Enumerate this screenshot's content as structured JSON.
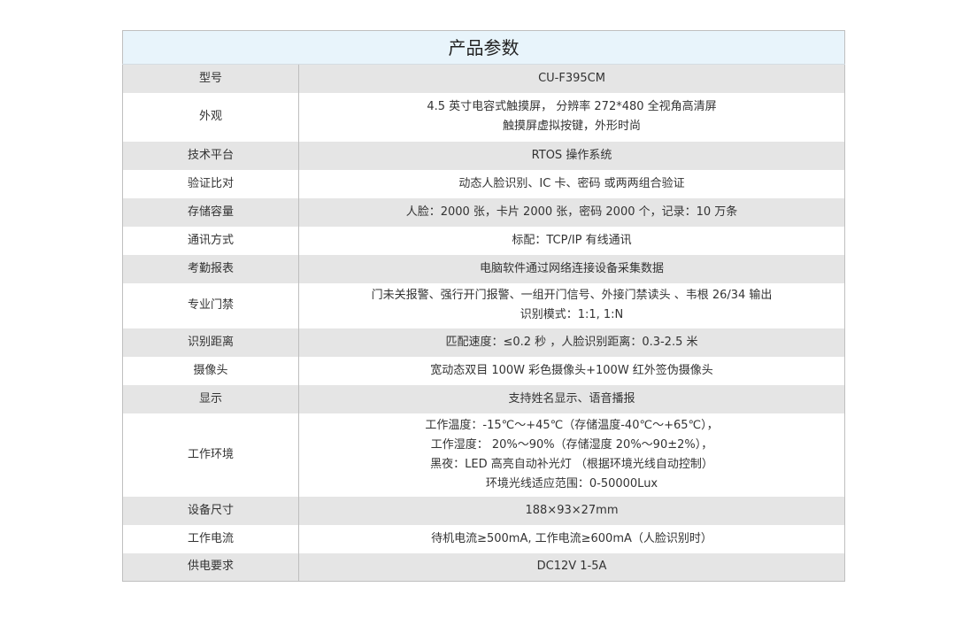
{
  "table": {
    "title": "产品参数",
    "rows": [
      {
        "label": "型号",
        "lines": [
          "CU-F395CM"
        ]
      },
      {
        "label": "外观",
        "lines": [
          "4.5 英寸电容式触摸屏， 分辨率 272*480 全视角高清屏",
          "触摸屏虚拟按键，外形时尚"
        ]
      },
      {
        "label": "技术平台",
        "lines": [
          "RTOS 操作系统"
        ]
      },
      {
        "label": "验证比对",
        "lines": [
          "动态人脸识别、IC 卡、密码 或两两组合验证"
        ]
      },
      {
        "label": "存储容量",
        "lines": [
          "人脸：2000 张，卡片 2000 张，密码 2000 个，记录：10 万条"
        ]
      },
      {
        "label": "通讯方式",
        "lines": [
          "标配：TCP/IP 有线通讯"
        ]
      },
      {
        "label": "考勤报表",
        "lines": [
          "电脑软件通过网络连接设备采集数据"
        ]
      },
      {
        "label": "专业门禁",
        "lines": [
          "门未关报警、强行开门报警、一组开门信号、外接门禁读头 、韦根 26/34 输出",
          "识别模式：1:1, 1:N"
        ]
      },
      {
        "label": "识别距离",
        "lines": [
          "匹配速度：≤0.2 秒 ，人脸识别距离：0.3-2.5 米"
        ]
      },
      {
        "label": "摄像头",
        "lines": [
          "宽动态双目 100W 彩色摄像头+100W 红外签伪摄像头"
        ]
      },
      {
        "label": "显示",
        "lines": [
          "支持姓名显示、语音播报"
        ]
      },
      {
        "label": "工作环境",
        "lines": [
          "工作温度：-15℃～+45℃（存储温度-40℃～+65℃），",
          "工作湿度： 20%～90%（存储湿度 20%～90±2%），",
          "黑夜：LED 高亮自动补光灯 （根据环境光线自动控制）",
          "环境光线适应范围：0-50000Lux"
        ]
      },
      {
        "label": "设备尺寸",
        "lines": [
          "188×93×27mm"
        ]
      },
      {
        "label": "工作电流",
        "lines": [
          "待机电流≥500mA, 工作电流≥600mA（人脸识别时）"
        ]
      },
      {
        "label": "供电要求",
        "lines": [
          "DC12V 1-5A"
        ]
      }
    ]
  }
}
